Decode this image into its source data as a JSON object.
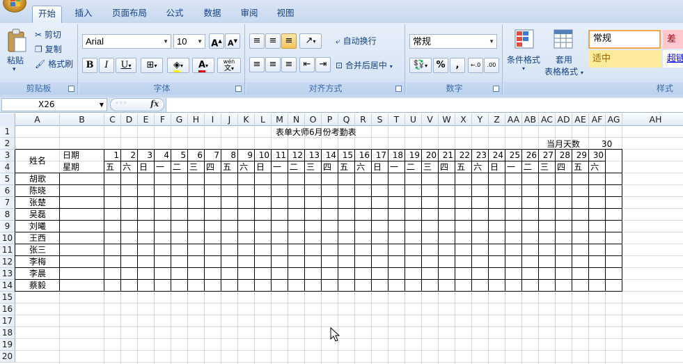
{
  "app": {
    "orb": "office-button"
  },
  "tabs": [
    {
      "label": "开始",
      "active": true
    },
    {
      "label": "插入"
    },
    {
      "label": "页面布局"
    },
    {
      "label": "公式"
    },
    {
      "label": "数据"
    },
    {
      "label": "审阅"
    },
    {
      "label": "视图"
    }
  ],
  "clipboard": {
    "paste": "粘贴",
    "cut": "剪切",
    "copy": "复制",
    "format_painter": "格式刷",
    "group": "剪贴板"
  },
  "font": {
    "name": "Arial",
    "size": "10",
    "bold": "B",
    "italic": "I",
    "underline": "U",
    "group": "字体",
    "grow": "A",
    "shrink": "A",
    "wen": "wén",
    "wen_char": "文"
  },
  "alignment": {
    "wrap": "自动换行",
    "merge": "合并后居中",
    "group": "对齐方式"
  },
  "number": {
    "format": "常规",
    "percent": "%",
    "comma": ",",
    "inc_dec": ".0→.00",
    "dec_dec": ".00→.0",
    "group": "数字"
  },
  "styles": {
    "conditional": "条件格式",
    "table_format_1": "套用",
    "table_format_2": "表格格式",
    "normal": "常规",
    "bad": "差",
    "neutral": "适中",
    "hyperlink": "超链",
    "group": "样式"
  },
  "formula_bar": {
    "name_box": "X26",
    "fx": "fx",
    "value": ""
  },
  "columns": [
    "A",
    "B",
    "C",
    "D",
    "E",
    "F",
    "G",
    "H",
    "I",
    "J",
    "K",
    "L",
    "M",
    "N",
    "O",
    "P",
    "Q",
    "R",
    "S",
    "T",
    "U",
    "V",
    "W",
    "X",
    "Y",
    "Z",
    "AA",
    "AB",
    "AC",
    "AD",
    "AE",
    "AF",
    "AG",
    "AH"
  ],
  "rows": [
    "1",
    "2",
    "3",
    "4",
    "5",
    "6",
    "7",
    "8",
    "9",
    "10",
    "11",
    "12",
    "13",
    "14",
    "15",
    "16",
    "17",
    "18",
    "19",
    "20"
  ],
  "sheet": {
    "title": "表单大师6月份考勤表",
    "days_label": "当月天数",
    "days_value": "30",
    "name_header": "姓名",
    "date_label": "日期",
    "weekday_label": "星期",
    "dates": [
      "1",
      "2",
      "3",
      "4",
      "5",
      "6",
      "7",
      "8",
      "9",
      "10",
      "11",
      "12",
      "13",
      "14",
      "15",
      "16",
      "17",
      "18",
      "19",
      "20",
      "21",
      "22",
      "23",
      "24",
      "25",
      "26",
      "27",
      "28",
      "29",
      "30"
    ],
    "weekdays": [
      "五",
      "六",
      "日",
      "一",
      "二",
      "三",
      "四",
      "五",
      "六",
      "日",
      "一",
      "二",
      "三",
      "四",
      "五",
      "六",
      "日",
      "一",
      "二",
      "三",
      "四",
      "五",
      "六",
      "日",
      "一",
      "二",
      "三",
      "四",
      "五",
      "六"
    ],
    "names": [
      "胡歌",
      "陈晓",
      "张楚",
      "吴磊",
      "刘曦",
      "王西",
      "张三",
      "李梅",
      "李晨",
      "蔡毅"
    ]
  }
}
